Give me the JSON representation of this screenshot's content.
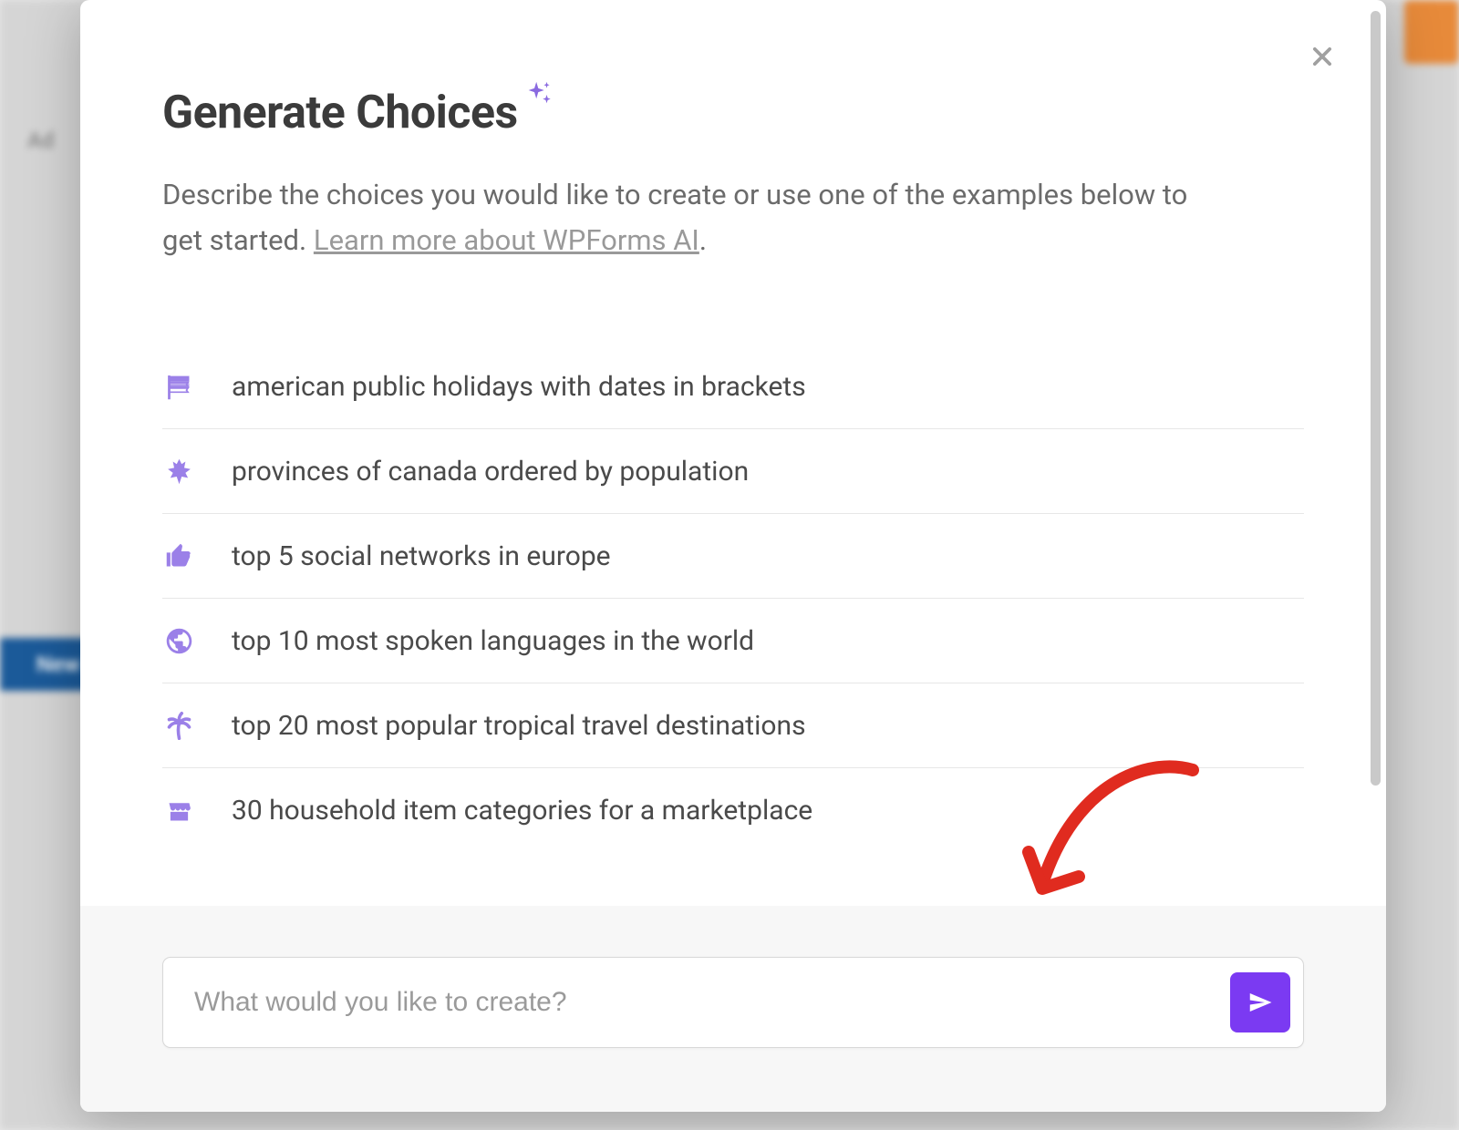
{
  "modal": {
    "title": "Generate Choices",
    "description_prefix": "Describe the choices you would like to create or use one of the examples below to get started. ",
    "learn_more_text": "Learn more about WPForms AI",
    "description_suffix": ".",
    "examples": [
      {
        "icon": "flag-icon",
        "text": "american public holidays with dates in brackets"
      },
      {
        "icon": "leaf-icon",
        "text": "provinces of canada ordered by population"
      },
      {
        "icon": "thumbs-up-icon",
        "text": "top 5 social networks in europe"
      },
      {
        "icon": "globe-icon",
        "text": "top 10 most spoken languages in the world"
      },
      {
        "icon": "palm-icon",
        "text": "top 20 most popular tropical travel destinations"
      },
      {
        "icon": "store-icon",
        "text": "30 household item categories for a marketplace"
      }
    ],
    "input": {
      "placeholder": "What would you like to create?"
    }
  },
  "colors": {
    "accent": "#7b3af2",
    "icon": "#9b80e8"
  }
}
